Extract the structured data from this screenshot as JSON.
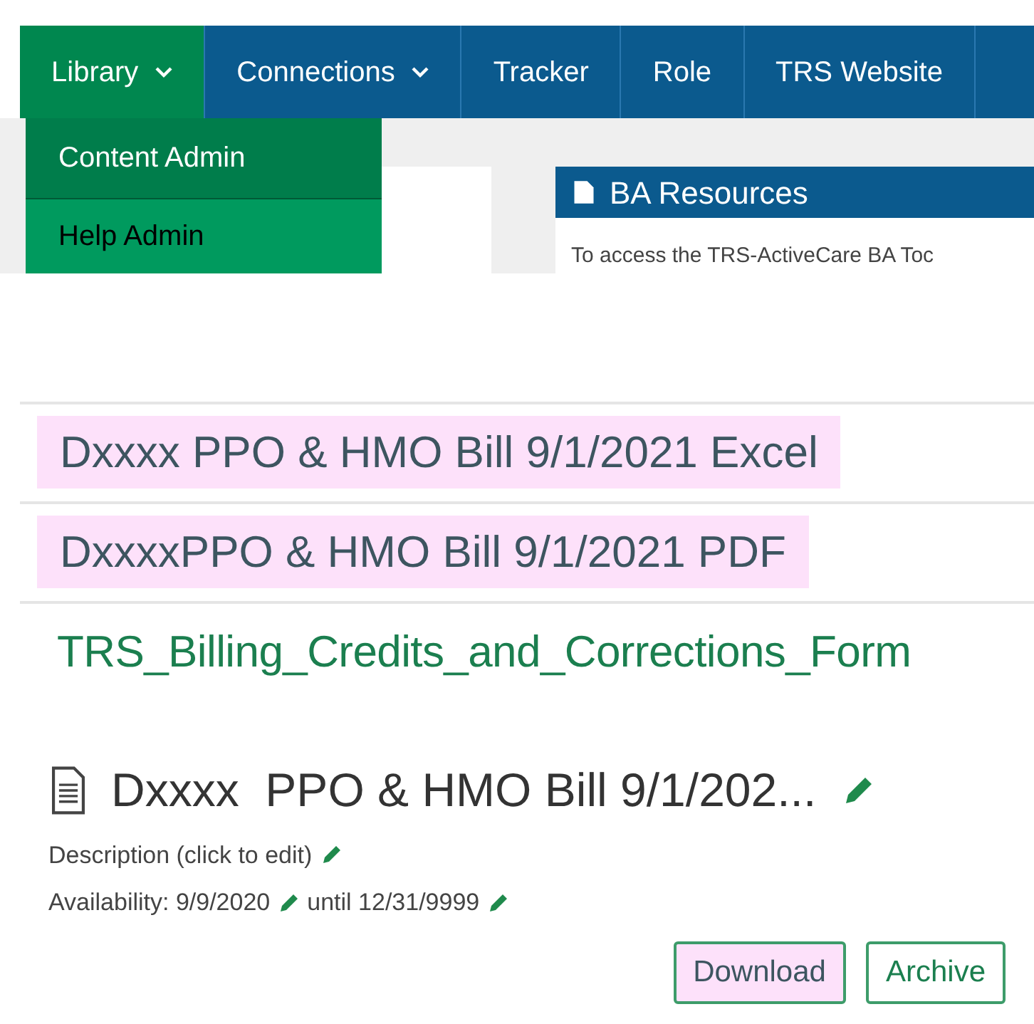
{
  "nav": {
    "tabs": [
      {
        "label": "Library",
        "dropdown": true,
        "selected": true
      },
      {
        "label": "Connections",
        "dropdown": true,
        "selected": false
      },
      {
        "label": "Tracker",
        "dropdown": false,
        "selected": false
      },
      {
        "label": "Role",
        "dropdown": false,
        "selected": false
      },
      {
        "label": "TRS Website",
        "dropdown": false,
        "selected": false
      }
    ],
    "menu": [
      {
        "label": "Content Admin",
        "selected": true
      },
      {
        "label": "Help Admin",
        "selected": false
      }
    ]
  },
  "panel": {
    "title": "BA Resources",
    "text": "To access the TRS-ActiveCare BA Toc"
  },
  "files": [
    {
      "kind": "file",
      "label": "Dxxxx PPO & HMO Bill 9/1/2021 Excel",
      "highlighted": true
    },
    {
      "kind": "file",
      "label": "DxxxxPPO & HMO Bill 9/1/2021 PDF",
      "highlighted": true
    },
    {
      "kind": "link",
      "label": "TRS_Billing_Credits_and_Corrections_Form",
      "highlighted": false
    }
  ],
  "detail": {
    "title": "Dxxxx  PPO & HMO Bill 9/1/202...",
    "description": "Description (click to edit)",
    "availability_label": "Availability: 9/9/2020",
    "until": "until 12/31/9999",
    "buttons": [
      {
        "label": "Download",
        "highlighted": true
      },
      {
        "label": "Archive",
        "highlighted": false
      }
    ]
  }
}
